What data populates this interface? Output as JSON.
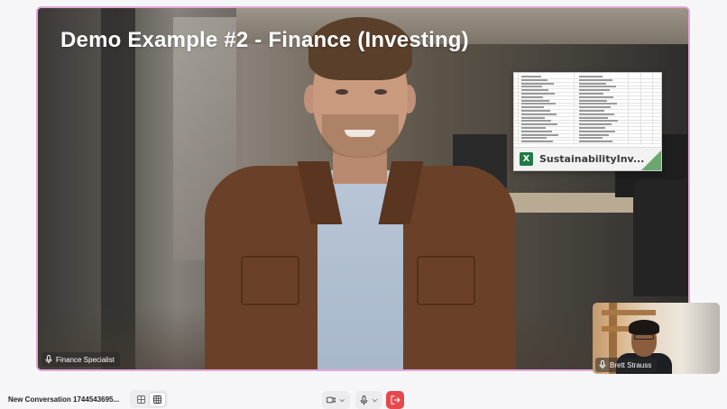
{
  "meeting": {
    "slide_title": "Demo Example #2 - Finance (Investing)",
    "speaker_name": "Finance Specialist",
    "self_name": "Brett Strauss",
    "shared_file": {
      "icon": "excel-icon",
      "icon_letter": "X",
      "name": "SustainabilityInv..."
    }
  },
  "toolbar": {
    "conversation_title": "New Conversation 1744543695...",
    "layout_icons": [
      "speaker-layout-icon",
      "grid-layout-icon"
    ],
    "camera_icon": "camera-icon",
    "mic_icon": "microphone-icon",
    "leave_icon": "leave-call-icon"
  },
  "colors": {
    "active_border": "#e2a7d8",
    "leave": "#e5484d",
    "excel": "#1f7a44"
  }
}
